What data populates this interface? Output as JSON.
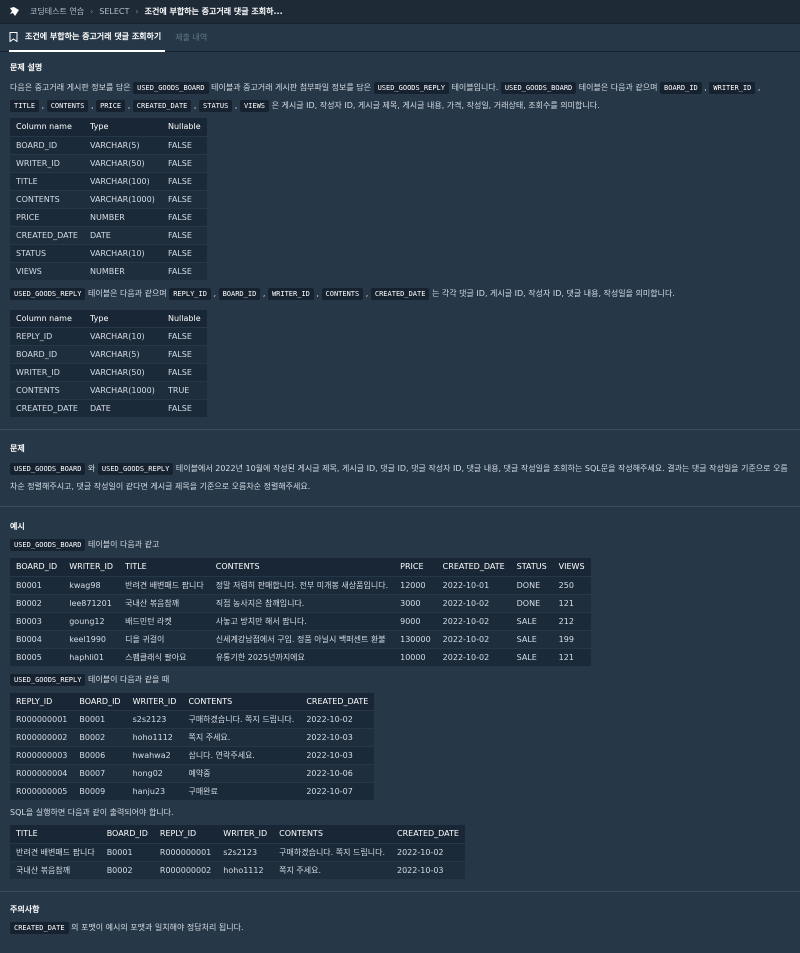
{
  "breadcrumb": {
    "items": [
      "코딩테스트 연습",
      "SELECT"
    ],
    "current": "조건에 부합하는 중고거래 댓글 조회하..."
  },
  "tabs": [
    {
      "label": "조건에 부합하는 중고거래 댓글 조회하기",
      "active": true
    },
    {
      "label": "제출 내역",
      "active": false
    }
  ],
  "description": {
    "title": "문제 설명",
    "intro": {
      "t1": "다음은 중고거래 게시판 정보를 담은",
      "c1": "USED_GOODS_BOARD",
      "t2": "테이블과 중고거래 게시판 첨부파일 정보를 담은",
      "c2": "USED_GOODS_REPLY",
      "t3": "테이블입니다.",
      "c3": "USED_GOODS_BOARD",
      "t4": "테이블은 다음과 같으며",
      "c4": "BOARD_ID",
      "c5": "WRITER_ID",
      "c6": "TITLE",
      "c7": "CONTENTS",
      "c8": "PRICE",
      "c9": "CREATED_DATE",
      "c10": "STATUS",
      "c11": "VIEWS",
      "t5": "은 게시글 ID, 작성자 ID, 게시글 제목, 게시글 내용, 가격, 작성일, 거래상태, 조회수를 의미합니다."
    },
    "board_schema": {
      "headers": [
        "Column name",
        "Type",
        "Nullable"
      ],
      "rows": [
        [
          "BOARD_ID",
          "VARCHAR(5)",
          "FALSE"
        ],
        [
          "WRITER_ID",
          "VARCHAR(50)",
          "FALSE"
        ],
        [
          "TITLE",
          "VARCHAR(100)",
          "FALSE"
        ],
        [
          "CONTENTS",
          "VARCHAR(1000)",
          "FALSE"
        ],
        [
          "PRICE",
          "NUMBER",
          "FALSE"
        ],
        [
          "CREATED_DATE",
          "DATE",
          "FALSE"
        ],
        [
          "STATUS",
          "VARCHAR(10)",
          "FALSE"
        ],
        [
          "VIEWS",
          "NUMBER",
          "FALSE"
        ]
      ]
    },
    "reply_intro": {
      "c1": "USED_GOODS_REPLY",
      "t1": "테이블은 다음과 같으며",
      "c2": "REPLY_ID",
      "c3": "BOARD_ID",
      "c4": "WRITER_ID",
      "c5": "CONTENTS",
      "c6": "CREATED_DATE",
      "t2": "는 각각 댓글 ID, 게시글 ID, 작성자 ID, 댓글 내용, 작성일을 의미합니다."
    },
    "reply_schema": {
      "headers": [
        "Column name",
        "Type",
        "Nullable"
      ],
      "rows": [
        [
          "REPLY_ID",
          "VARCHAR(10)",
          "FALSE"
        ],
        [
          "BOARD_ID",
          "VARCHAR(5)",
          "FALSE"
        ],
        [
          "WRITER_ID",
          "VARCHAR(50)",
          "FALSE"
        ],
        [
          "CONTENTS",
          "VARCHAR(1000)",
          "TRUE"
        ],
        [
          "CREATED_DATE",
          "DATE",
          "FALSE"
        ]
      ]
    }
  },
  "problem": {
    "title": "문제",
    "c1": "USED_GOODS_BOARD",
    "t1": "와",
    "c2": "USED_GOODS_REPLY",
    "t2": "테이블에서 2022년 10월에 작성된 게시글 제목, 게시글 ID, 댓글 ID, 댓글 작성자 ID, 댓글 내용, 댓글 작성일을 조회하는 SQL문을 작성해주세요. 결과는 댓글 작성일을 기준으로 오름차순 정렬해주시고, 댓글 작성일이 같다면 게시글 제목을 기준으로 오름차순 정렬해주세요."
  },
  "example": {
    "title": "예시",
    "board_intro": {
      "c1": "USED_GOODS_BOARD",
      "t1": "테이블이 다음과 같고"
    },
    "board_table": {
      "headers": [
        "BOARD_ID",
        "WRITER_ID",
        "TITLE",
        "CONTENTS",
        "PRICE",
        "CREATED_DATE",
        "STATUS",
        "VIEWS"
      ],
      "rows": [
        [
          "B0001",
          "kwag98",
          "반려견 배변패드 팝니다",
          "정말 저렴히 판매합니다. 전부 미개봉 새상품입니다.",
          "12000",
          "2022-10-01",
          "DONE",
          "250"
        ],
        [
          "B0002",
          "lee871201",
          "국내산 볶음참깨",
          "직접 농사지은 참깨입니다.",
          "3000",
          "2022-10-02",
          "DONE",
          "121"
        ],
        [
          "B0003",
          "goung12",
          "배드민턴 라켓",
          "사놓고 방치만 해서 팝니다.",
          "9000",
          "2022-10-02",
          "SALE",
          "212"
        ],
        [
          "B0004",
          "keel1990",
          "디올 귀걸이",
          "신세계강남점에서 구입. 정품 아닐시 백퍼센트 환불",
          "130000",
          "2022-10-02",
          "SALE",
          "199"
        ],
        [
          "B0005",
          "haphli01",
          "스팸클래식 팔아요",
          "유통기한 2025년까지에요",
          "10000",
          "2022-10-02",
          "SALE",
          "121"
        ]
      ]
    },
    "reply_intro": {
      "c1": "USED_GOODS_REPLY",
      "t1": "테이블이 다음과 같을 때"
    },
    "reply_table": {
      "headers": [
        "REPLY_ID",
        "BOARD_ID",
        "WRITER_ID",
        "CONTENTS",
        "CREATED_DATE"
      ],
      "rows": [
        [
          "R000000001",
          "B0001",
          "s2s2123",
          "구매하겠습니다. 쪽지 드립니다.",
          "2022-10-02"
        ],
        [
          "R000000002",
          "B0002",
          "hoho1112",
          "쪽지 주세요.",
          "2022-10-03"
        ],
        [
          "R000000003",
          "B0006",
          "hwahwa2",
          "삽니다. 연락주세요.",
          "2022-10-03"
        ],
        [
          "R000000004",
          "B0007",
          "hong02",
          "예약중",
          "2022-10-06"
        ],
        [
          "R000000005",
          "B0009",
          "hanju23",
          "구매완료",
          "2022-10-07"
        ]
      ]
    },
    "result_intro": "SQL을 실행하면 다음과 같이 출력되어야 합니다.",
    "result_table": {
      "headers": [
        "TITLE",
        "BOARD_ID",
        "REPLY_ID",
        "WRITER_ID",
        "CONTENTS",
        "CREATED_DATE"
      ],
      "rows": [
        [
          "반려견 배변패드 팝니다",
          "B0001",
          "R000000001",
          "s2s2123",
          "구매하겠습니다. 쪽지 드립니다.",
          "2022-10-02"
        ],
        [
          "국내산 볶음참깨",
          "B0002",
          "R000000002",
          "hoho1112",
          "쪽지 주세요.",
          "2022-10-03"
        ]
      ]
    }
  },
  "notes": {
    "title": "주의사항",
    "c1": "CREATED_DATE",
    "t1": "의 포맷이 예시의 포맷과 일치해야 정답처리 됩니다."
  }
}
